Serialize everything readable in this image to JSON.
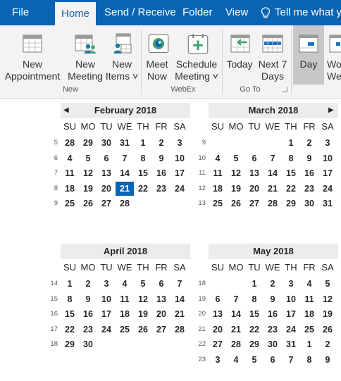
{
  "tabs": {
    "file": "File",
    "home": "Home",
    "send_receive": "Send / Receive",
    "folder": "Folder",
    "view": "View",
    "tell_me": "Tell me what yo"
  },
  "ribbon": {
    "new_appointment": [
      "New",
      "Appointment"
    ],
    "new_meeting": [
      "New",
      "Meeting"
    ],
    "new_items": [
      "New",
      "Items ˅"
    ],
    "meet_now": [
      "Meet",
      "Now"
    ],
    "schedule_meeting": [
      "Schedule",
      "Meeting ˅"
    ],
    "today": [
      "Today",
      ""
    ],
    "next_7_days": [
      "Next 7",
      "Days"
    ],
    "day": [
      "Day",
      ""
    ],
    "work_week": [
      "Wo",
      "We"
    ],
    "groups": {
      "new": "New",
      "webex": "WebEx",
      "goto": "Go To"
    }
  },
  "colors": {
    "brand": "#0a64b4",
    "today_highlight": "#0a64b4"
  },
  "day_headers": [
    "SU",
    "MO",
    "TU",
    "WE",
    "TH",
    "FR",
    "SA"
  ],
  "calendars": [
    {
      "title": "February 2018",
      "nav": "prev",
      "nav_glyph": "◀",
      "week_numbers": [
        "5",
        "6",
        "7",
        "8",
        "9",
        ""
      ],
      "weeks": [
        [
          "28",
          "29",
          "30",
          "31",
          "1",
          "2",
          "3"
        ],
        [
          "4",
          "5",
          "6",
          "7",
          "8",
          "9",
          "10"
        ],
        [
          "11",
          "12",
          "13",
          "14",
          "15",
          "16",
          "17"
        ],
        [
          "18",
          "19",
          "20",
          "21",
          "22",
          "23",
          "24"
        ],
        [
          "25",
          "26",
          "27",
          "28",
          "",
          "",
          ""
        ],
        [
          "",
          "",
          "",
          "",
          "",
          "",
          ""
        ]
      ],
      "today": "21"
    },
    {
      "title": "March 2018",
      "nav": "next",
      "nav_glyph": "▶",
      "week_numbers": [
        "9",
        "10",
        "11",
        "12",
        "13",
        ""
      ],
      "weeks": [
        [
          "",
          "",
          "",
          "",
          "1",
          "2",
          "3"
        ],
        [
          "4",
          "5",
          "6",
          "7",
          "8",
          "9",
          "10"
        ],
        [
          "11",
          "12",
          "13",
          "14",
          "15",
          "16",
          "17"
        ],
        [
          "18",
          "19",
          "20",
          "21",
          "22",
          "23",
          "24"
        ],
        [
          "25",
          "26",
          "27",
          "28",
          "29",
          "30",
          "31"
        ],
        [
          "",
          "",
          "",
          "",
          "",
          "",
          ""
        ]
      ],
      "today": ""
    },
    {
      "title": "April 2018",
      "nav": "",
      "nav_glyph": "",
      "week_numbers": [
        "14",
        "15",
        "16",
        "17",
        "18",
        ""
      ],
      "weeks": [
        [
          "1",
          "2",
          "3",
          "4",
          "5",
          "6",
          "7"
        ],
        [
          "8",
          "9",
          "10",
          "11",
          "12",
          "13",
          "14"
        ],
        [
          "15",
          "16",
          "17",
          "18",
          "19",
          "20",
          "21"
        ],
        [
          "22",
          "23",
          "24",
          "25",
          "26",
          "27",
          "28"
        ],
        [
          "29",
          "30",
          "",
          "",
          "",
          "",
          ""
        ],
        [
          "",
          "",
          "",
          "",
          "",
          "",
          ""
        ]
      ],
      "today": ""
    },
    {
      "title": "May 2018",
      "nav": "",
      "nav_glyph": "",
      "week_numbers": [
        "18",
        "19",
        "20",
        "21",
        "22",
        "23"
      ],
      "weeks": [
        [
          "",
          "",
          "1",
          "2",
          "3",
          "4",
          "5"
        ],
        [
          "6",
          "7",
          "8",
          "9",
          "10",
          "11",
          "12"
        ],
        [
          "13",
          "14",
          "15",
          "16",
          "17",
          "18",
          "19"
        ],
        [
          "20",
          "21",
          "22",
          "23",
          "24",
          "25",
          "26"
        ],
        [
          "27",
          "28",
          "29",
          "30",
          "31",
          "1",
          "2"
        ],
        [
          "3",
          "4",
          "5",
          "6",
          "7",
          "8",
          "9"
        ]
      ],
      "today": ""
    }
  ]
}
